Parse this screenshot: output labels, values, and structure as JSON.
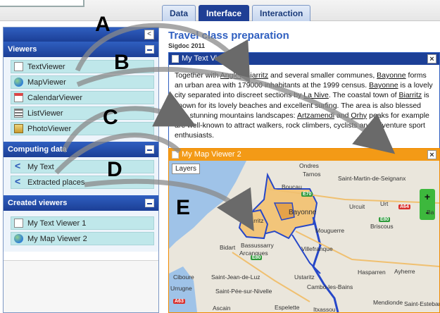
{
  "tabs": [
    {
      "label": "Data",
      "active": false
    },
    {
      "label": "Interface",
      "active": true
    },
    {
      "label": "Interaction",
      "active": false
    }
  ],
  "leftpanel": {
    "collapse_label": "<",
    "sections": [
      {
        "title": "Viewers",
        "items": [
          {
            "label": "TextViewer",
            "icon": "document-icon"
          },
          {
            "label": "MapViewer",
            "icon": "globe-icon"
          },
          {
            "label": "CalendarViewer",
            "icon": "calendar-icon"
          },
          {
            "label": "ListViewer",
            "icon": "list-icon"
          },
          {
            "label": "PhotoViewer",
            "icon": "photo-icon"
          }
        ]
      },
      {
        "title": "Computing data",
        "items": [
          {
            "label": "My Text",
            "icon": "share-icon"
          },
          {
            "label": "Extracted places",
            "icon": "share-icon"
          }
        ]
      },
      {
        "title": "Created viewers",
        "items": [
          {
            "label": "My Text Viewer 1",
            "icon": "document-icon"
          },
          {
            "label": "My Map Viewer 2",
            "icon": "globe-icon"
          }
        ]
      }
    ]
  },
  "document": {
    "title": "Travel class preparation",
    "subtitle": "Sigdoc 2011"
  },
  "text_viewer": {
    "title": "My Text Viewer 1",
    "close_label": "×",
    "body_html_parts": [
      "Together with ",
      "Anglet",
      ", ",
      "Biarritz",
      " and several smaller communes, ",
      "Bayonne",
      " forms an urban area with 179000 inhabitants at the 1999 census. ",
      "Bayonne",
      " is a lovely city separated into discreet sections by ",
      "La Nive",
      ". The coastal town of ",
      "Biarritz",
      " is known for its lovely beaches and excellent surfing. The area is also blessed with stunning mountains landscapes: ",
      "Artzamendi",
      " and ",
      "Orhy",
      " peaks for example are well-known to attract walkers, rock climbers, cyclists and adventure sport enthusiasts."
    ]
  },
  "map_viewer": {
    "title": "My Map Viewer 2",
    "close_label": "×",
    "layers_label": "Layers",
    "zoom_in": "+",
    "zoom_out": "-",
    "places": [
      "Ondres",
      "Tarnos",
      "Saint-Martin-de-Seignanx",
      "Boucau",
      "Bayonne",
      "Biarritz",
      "Urcuit",
      "Urt",
      "Ba",
      "Mouguerre",
      "Briscous",
      "Bidart",
      "Arcangues",
      "Bassussarry",
      "Villefranque",
      "Ciboure",
      "Saint-Jean-de-Luz",
      "Ustaritz",
      "Hasparren",
      "Ayherre",
      "Urrugne",
      "Saint-Pée-sur-Nivelle",
      "Cambo-les-Bains",
      "Ascain",
      "Espelette",
      "Itxassou",
      "Mendionde",
      "Saint-Esteban"
    ],
    "roads": [
      "E70",
      "A64",
      "E80",
      "E80",
      "A63"
    ]
  },
  "annotations": [
    "A",
    "B",
    "C",
    "D",
    "E"
  ],
  "colors": {
    "primary": "#1c3f96",
    "accent_orange": "#f39a16",
    "item_bg": "#bfe7ea",
    "title_blue": "#2f5fc0"
  }
}
